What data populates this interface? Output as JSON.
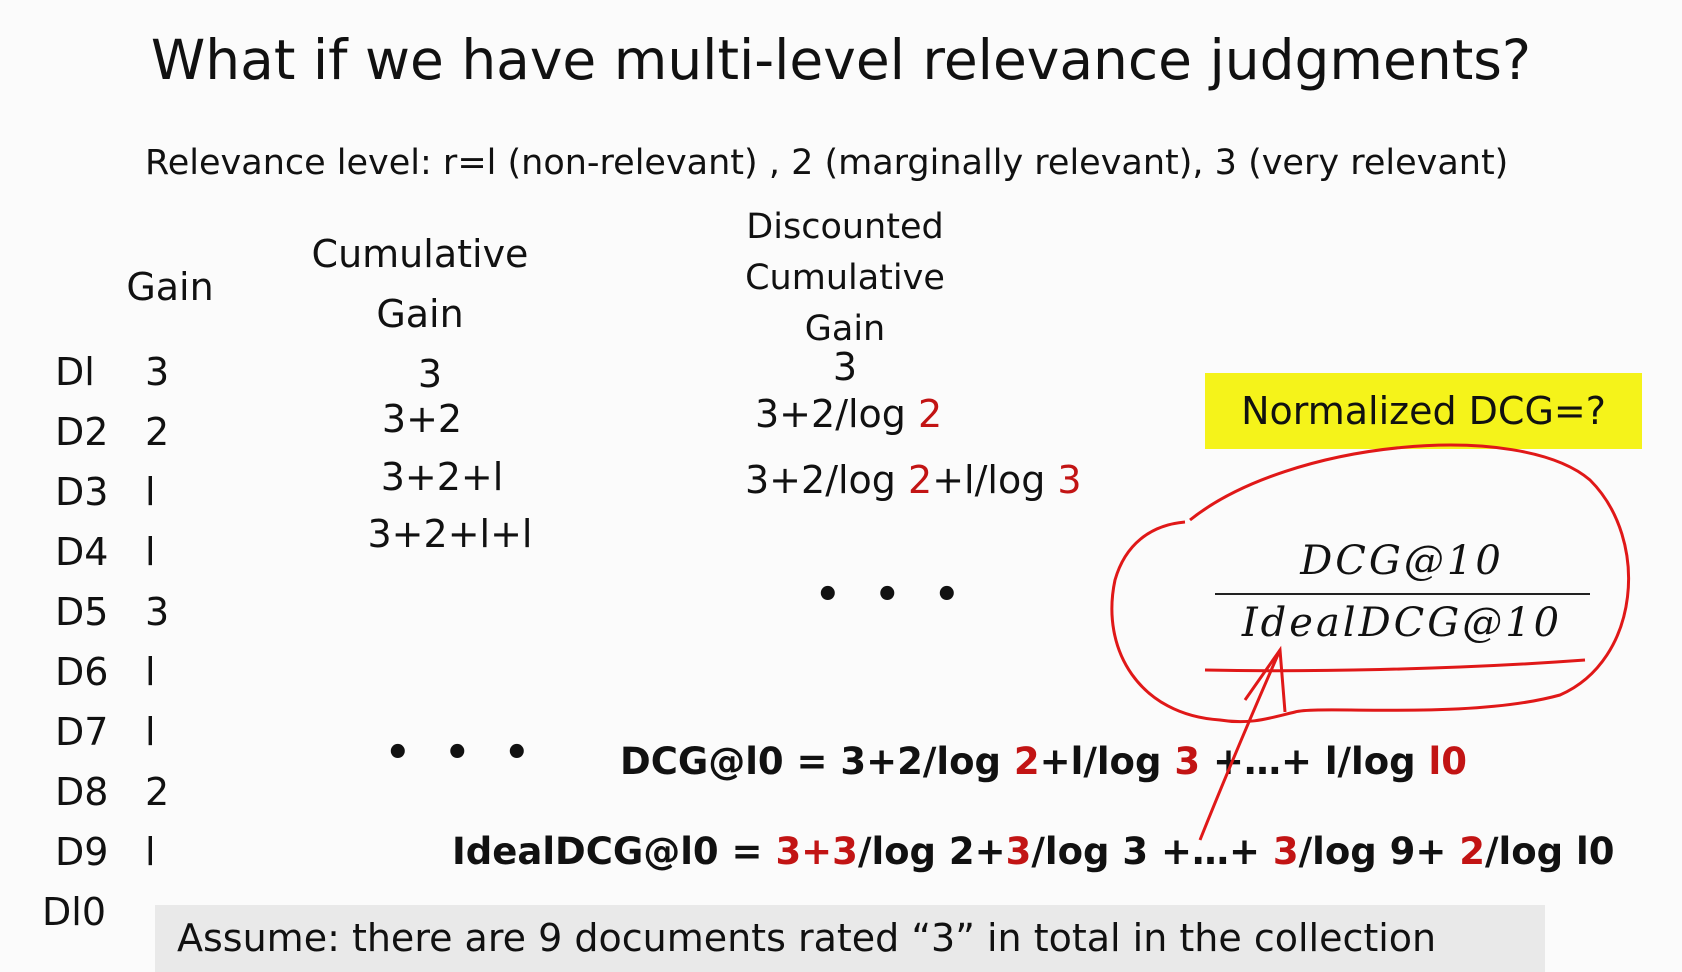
{
  "title": "What if we have multi-level relevance judgments?",
  "subtitle": "Relevance level:   r=l  (non-relevant) , 2  (marginally relevant), 3  (very relevant)",
  "headers": {
    "gain": "Gain",
    "cg_line1": "Cumulative",
    "cg_line2": "Gain",
    "dcg_line1": "Discounted",
    "dcg_line2": "Cumulative",
    "dcg_line3": "Gain"
  },
  "docs": [
    {
      "id": "Dl",
      "gain": "3"
    },
    {
      "id": "D2",
      "gain": "2"
    },
    {
      "id": "D3",
      "gain": "l"
    },
    {
      "id": "D4",
      "gain": "l"
    },
    {
      "id": "D5",
      "gain": "3"
    },
    {
      "id": "D6",
      "gain": "l"
    },
    {
      "id": "D7",
      "gain": "l"
    },
    {
      "id": "D8",
      "gain": "2"
    },
    {
      "id": "D9",
      "gain": "l"
    },
    {
      "id": "Dl0",
      "gain": ""
    }
  ],
  "cumulative": [
    "3",
    "3+2",
    "3+2+l",
    "3+2+l+l"
  ],
  "dcg": {
    "row1": "3",
    "row2": {
      "a": "3+2/log ",
      "b": "2"
    },
    "row3": {
      "a": "3+2/log ",
      "b": "2",
      "c": "+l/log ",
      "d": "3"
    }
  },
  "ellipsis": "• • •",
  "ndcg_label": "Normalized DCG=?",
  "fraction": {
    "numerator": "DCG@10",
    "denominator": "IdealDCG@10"
  },
  "dcg10": {
    "p1": "DCG@l0 = 3+2/log ",
    "r1": "2",
    "p2": "+l/log ",
    "r2": "3",
    "p3": " +…+ l/log ",
    "r3": "l0"
  },
  "ideal": {
    "p1": "IdealDCG@l0 = ",
    "r1": "3+3",
    "p2": "/log 2+",
    "r2": "3",
    "p3": "/log 3 +…+ ",
    "r3": "3",
    "p4": "/log 9+ ",
    "r4": "2",
    "p5": "/log l0"
  },
  "note": "Assume:  there are 9 documents rated “3” in total in the collection",
  "colors": {
    "accent_red": "#c21414",
    "highlight_yellow": "#f5f31a",
    "ink_red": "#e01818"
  }
}
